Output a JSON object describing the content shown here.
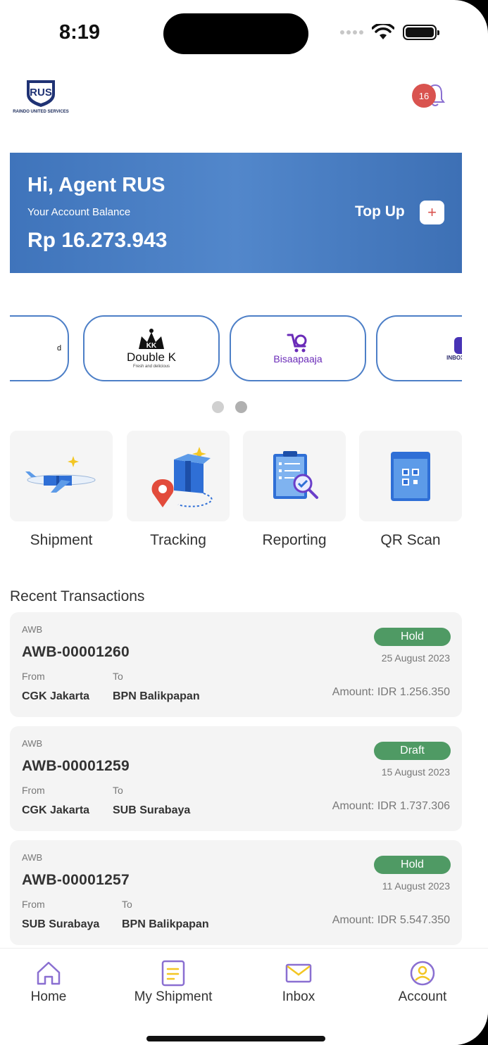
{
  "status_bar": {
    "time": "8:19"
  },
  "header": {
    "logo_text": "RUS",
    "logo_caption": "RAINDO UNITED SERVICES",
    "notification_count": "16"
  },
  "balance_card": {
    "greeting": "Hi, Agent RUS",
    "label": "Your Account Balance",
    "amount": "Rp 16.273.943",
    "topup_label": "Top Up",
    "topup_icon": "+"
  },
  "partners": [
    {
      "name": "d"
    },
    {
      "name": "Double K",
      "sub": "Fresh and delicious"
    },
    {
      "name": "Bisaapaaja"
    },
    {
      "name": "INBOX-MEDIA"
    }
  ],
  "menu": [
    {
      "label": "Shipment"
    },
    {
      "label": "Tracking"
    },
    {
      "label": "Reporting"
    },
    {
      "label": "QR Scan"
    }
  ],
  "recent": {
    "title": "Recent Transactions",
    "items": [
      {
        "awb_label": "AWB",
        "awb": "AWB-00001260",
        "from_label": "From",
        "to_label": "To",
        "from": "CGK Jakarta",
        "to": "BPN Balikpapan",
        "status": "Hold",
        "date": "25 August 2023",
        "amount": "Amount: IDR 1.256.350"
      },
      {
        "awb_label": "AWB",
        "awb": "AWB-00001259",
        "from_label": "From",
        "to_label": "To",
        "from": "CGK Jakarta",
        "to": "SUB Surabaya",
        "status": "Draft",
        "date": "15 August 2023",
        "amount": "Amount: IDR 1.737.306"
      },
      {
        "awb_label": "AWB",
        "awb": "AWB-00001257",
        "from_label": "From",
        "to_label": "To",
        "from": "SUB Surabaya",
        "to": "BPN Balikpapan",
        "status": "Hold",
        "date": "11 August 2023",
        "amount": "Amount: IDR 5.547.350"
      }
    ]
  },
  "tabbar": [
    {
      "label": "Home",
      "icon": "home-icon"
    },
    {
      "label": "My Shipment",
      "icon": "document-icon"
    },
    {
      "label": "Inbox",
      "icon": "mail-icon"
    },
    {
      "label": "Account",
      "icon": "user-icon"
    }
  ],
  "colors": {
    "accent": "#4d7fc7",
    "status_green": "#4f9a64",
    "badge_red": "#d9534f",
    "tab_icon": "#8a6fd1"
  }
}
